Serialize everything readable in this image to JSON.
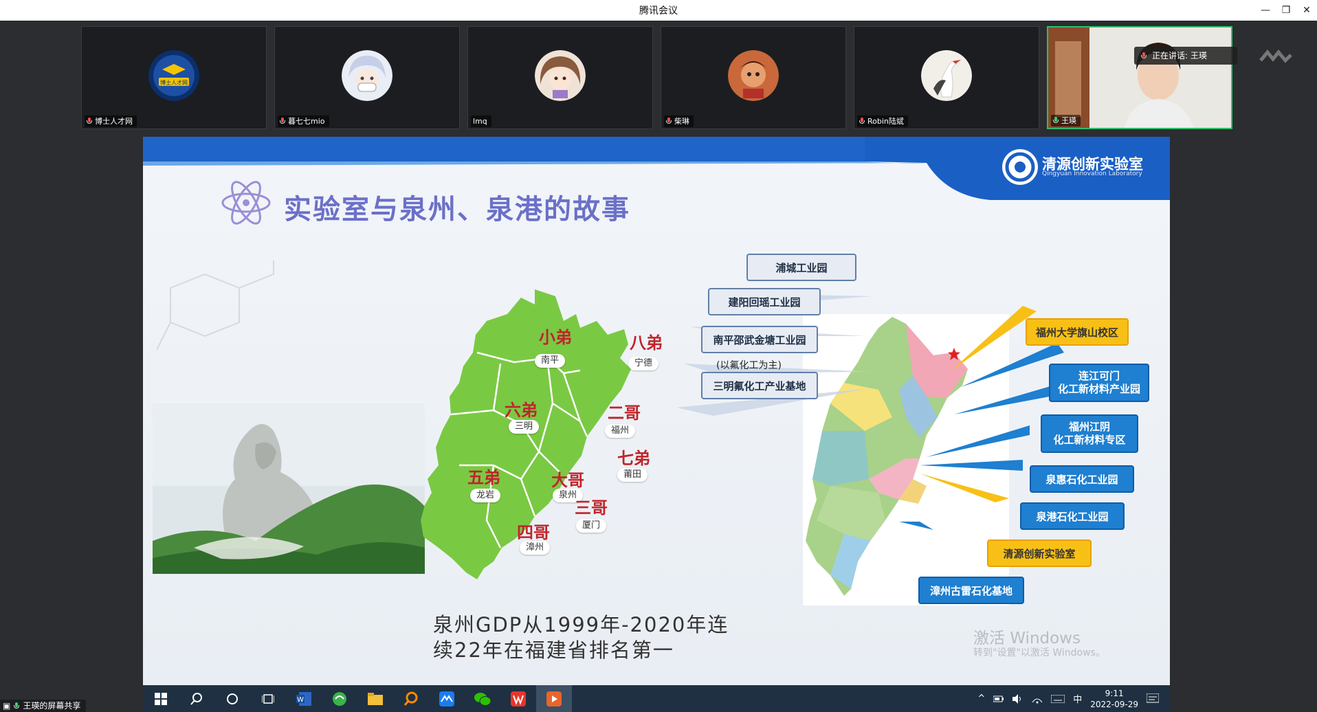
{
  "window": {
    "title": "腾讯会议"
  },
  "participants": [
    {
      "name": "博士人才网",
      "avatar_text": "博士人才网"
    },
    {
      "name": "暮七七mio"
    },
    {
      "name": "lmq"
    },
    {
      "name": "柴琳"
    },
    {
      "name": "Robin陆斌"
    },
    {
      "name": "王瑛"
    }
  ],
  "speaking": {
    "label": "正在讲话: 王瑛"
  },
  "slide": {
    "title": "实验室与泉州、泉港的故事",
    "logo_title": "清源创新实验室",
    "logo_subtitle": "Qingyuan Innovation Laboratory",
    "map_labels": [
      {
        "rank": "小弟",
        "city": "南平"
      },
      {
        "rank": "八弟",
        "city": "宁德"
      },
      {
        "rank": "六弟",
        "city": "三明"
      },
      {
        "rank": "二哥",
        "city": "福州"
      },
      {
        "rank": "七弟",
        "city": "莆田"
      },
      {
        "rank": "五弟",
        "city": "龙岩"
      },
      {
        "rank": "大哥",
        "city": "泉州"
      },
      {
        "rank": "三哥",
        "city": "厦门"
      },
      {
        "rank": "四哥",
        "city": "漳州"
      }
    ],
    "callouts_left": [
      "浦城工业园",
      "建阳回瑶工业园",
      "南平邵武金塘工业园",
      "三明氟化工产业基地"
    ],
    "callout_note": "(以氟化工为主)",
    "callouts_right": [
      "福州大学旗山校区",
      "连江可门\n化工新材料产业园",
      "福州江阴\n化工新材料专区",
      "泉惠石化工业园",
      "泉港石化工业园",
      "清源创新实验室",
      "漳州古雷石化基地"
    ],
    "caption_line1": "泉州GDP从1999年-2020年连",
    "caption_line2": "续22年在福建省排名第一",
    "watermark_line1": "激活 Windows",
    "watermark_line2": "转到\"设置\"以激活 Windows。"
  },
  "taskbar": {
    "time": "9:11",
    "date": "2022-09-29",
    "ime": "中"
  },
  "share_label": "王瑛的屏幕共享",
  "colors": {
    "map_green": "#7ac943",
    "rank_red": "#c0242b",
    "callout_blue": "#1f7fd0",
    "callout_gold": "#f8c016"
  }
}
